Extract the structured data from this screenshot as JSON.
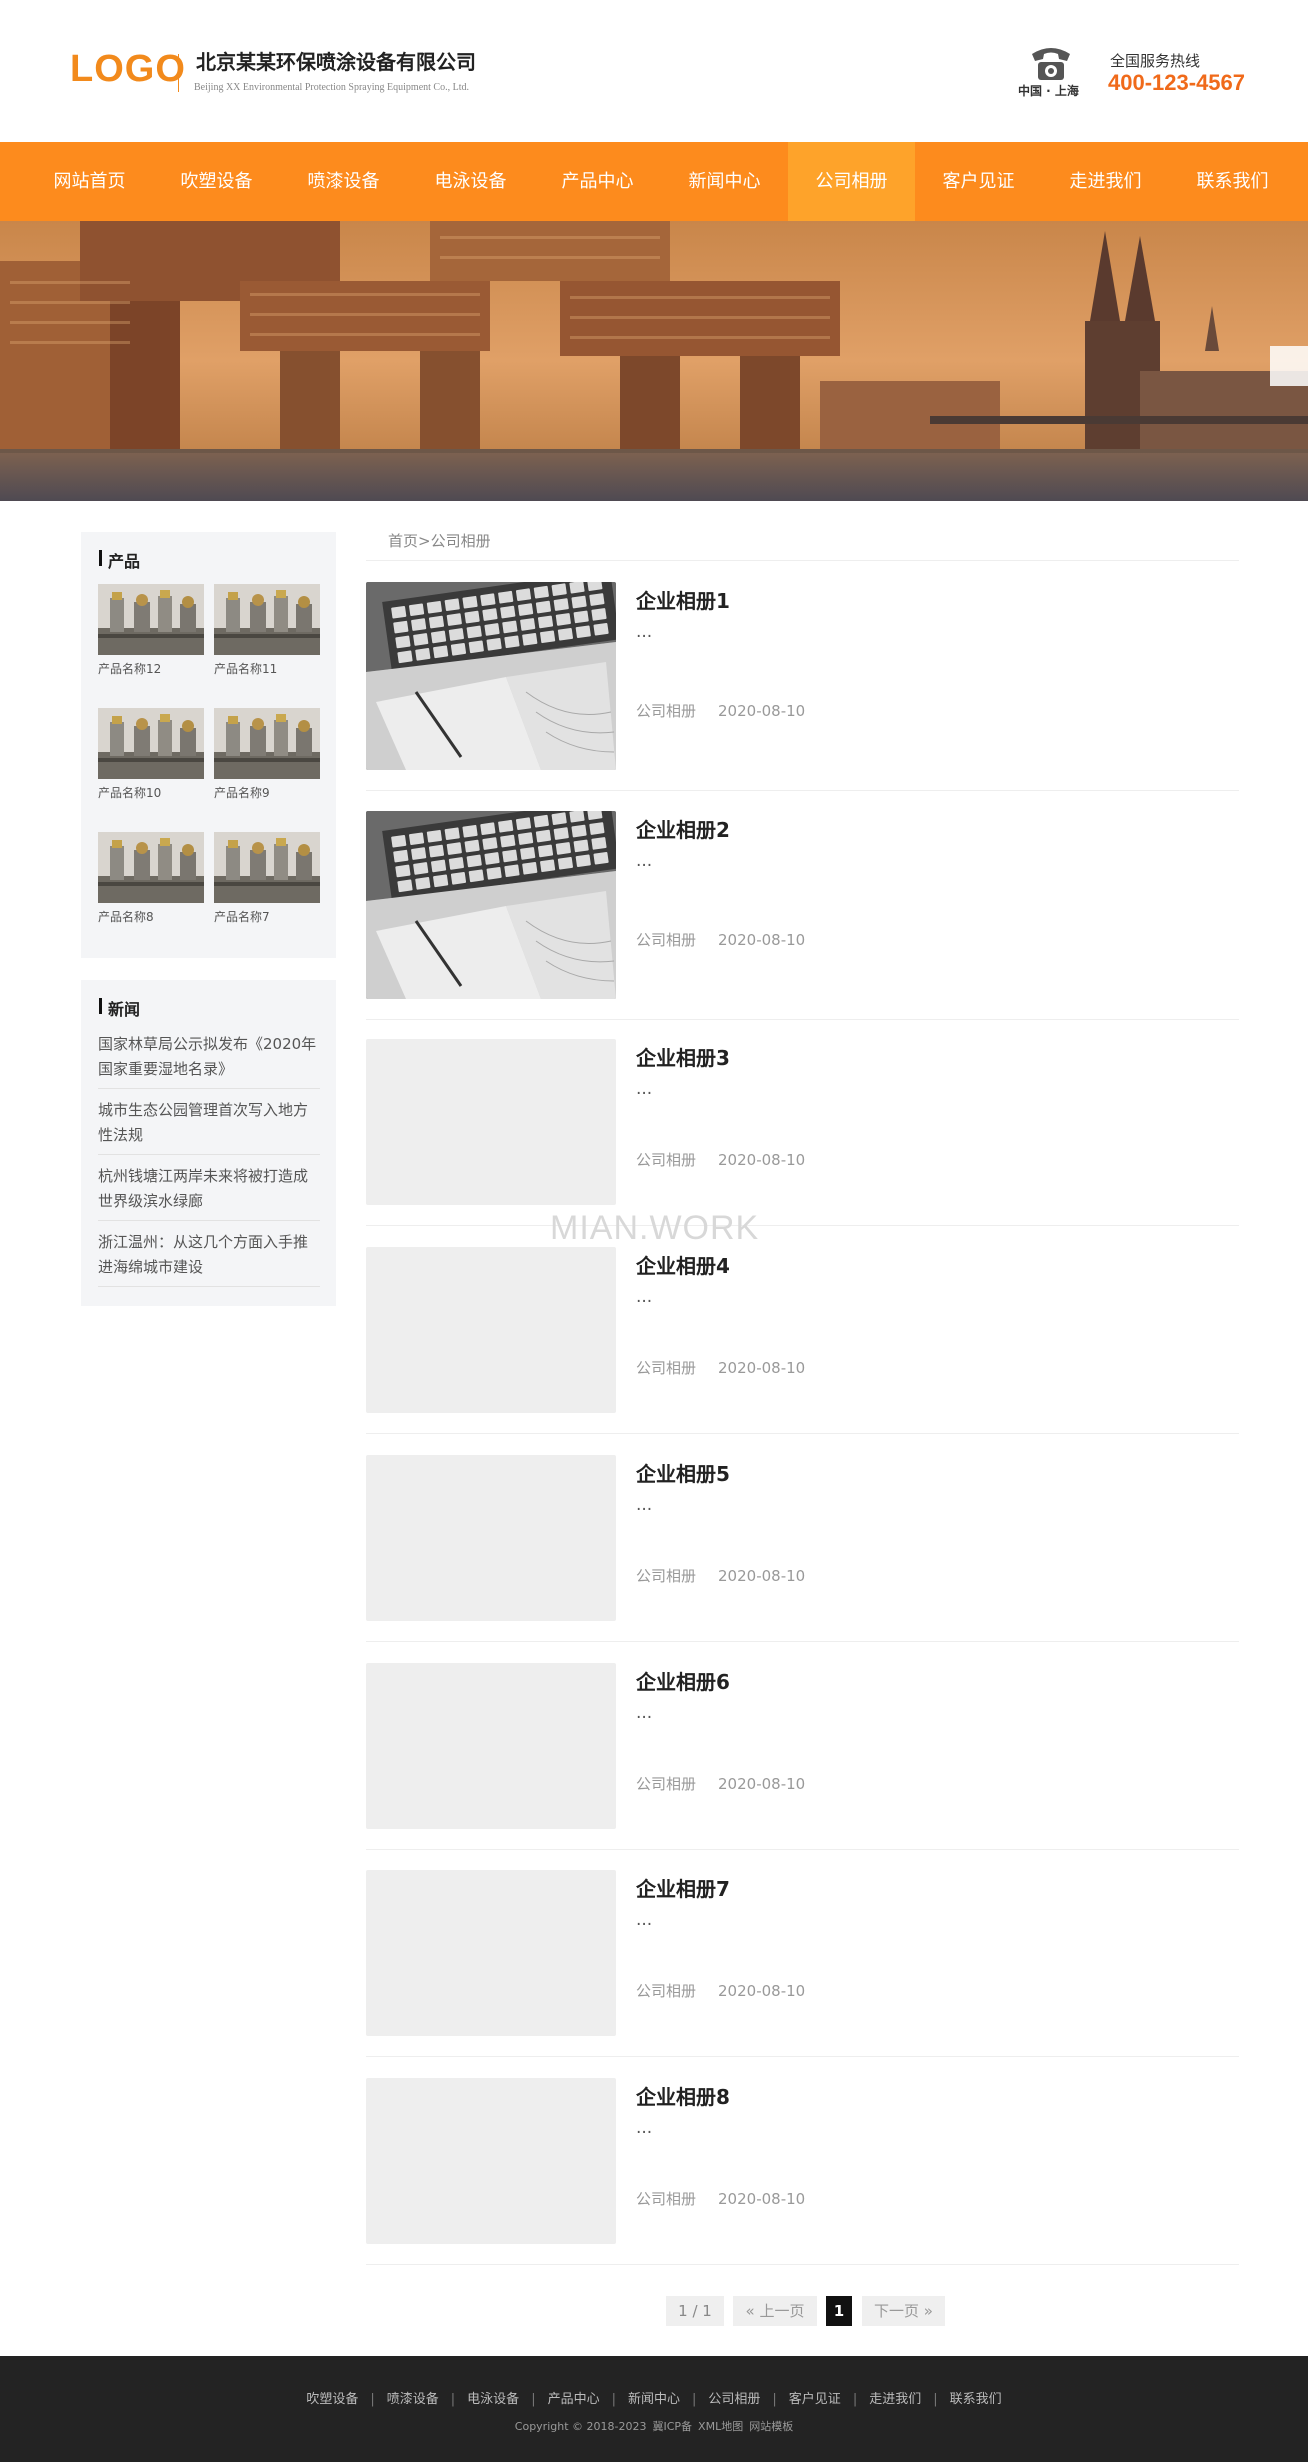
{
  "header": {
    "logo_text": "LOGO",
    "company_name": "北京某某环保喷涂设备有限公司",
    "company_name_en": "Beijing XX Environmental Protection Spraying Equipment Co., Ltd.",
    "phone_region": "中国 · 上海",
    "hotline_label": "全国服务热线",
    "hotline_number": "400-123-4567"
  },
  "nav": {
    "items": [
      "网站首页",
      "吹塑设备",
      "喷漆设备",
      "电泳设备",
      "产品中心",
      "新闻中心",
      "公司相册",
      "客户见证",
      "走进我们",
      "联系我们"
    ],
    "active_index": 6
  },
  "sidebar": {
    "products_title": "产品",
    "products": [
      "产品名称12",
      "产品名称11",
      "产品名称10",
      "产品名称9",
      "产品名称8",
      "产品名称7"
    ],
    "news_title": "新闻",
    "news": [
      "国家林草局公示拟发布《2020年国家重要湿地名录》",
      "城市生态公园管理首次写入地方性法规",
      "杭州钱塘江两岸未来将被打造成世界级滨水绿廊",
      "浙江温州：从这几个方面入手推进海绵城市建设"
    ]
  },
  "breadcrumb": {
    "home": "首页",
    "separator": ">",
    "current": "公司相册"
  },
  "entries": [
    {
      "title": "企业相册1",
      "desc": "...",
      "category": "公司相册",
      "date": "2020-08-10",
      "has_image": true
    },
    {
      "title": "企业相册2",
      "desc": "...",
      "category": "公司相册",
      "date": "2020-08-10",
      "has_image": true
    },
    {
      "title": "企业相册3",
      "desc": "...",
      "category": "公司相册",
      "date": "2020-08-10",
      "has_image": false
    },
    {
      "title": "企业相册4",
      "desc": "...",
      "category": "公司相册",
      "date": "2020-08-10",
      "has_image": false
    },
    {
      "title": "企业相册5",
      "desc": "...",
      "category": "公司相册",
      "date": "2020-08-10",
      "has_image": false
    },
    {
      "title": "企业相册6",
      "desc": "...",
      "category": "公司相册",
      "date": "2020-08-10",
      "has_image": false
    },
    {
      "title": "企业相册7",
      "desc": "...",
      "category": "公司相册",
      "date": "2020-08-10",
      "has_image": false
    },
    {
      "title": "企业相册8",
      "desc": "...",
      "category": "公司相册",
      "date": "2020-08-10",
      "has_image": false
    }
  ],
  "watermark": "MIAN.WORK",
  "pagination": {
    "info": "1 / 1",
    "prev": "« 上一页",
    "current": "1",
    "next": "下一页 »"
  },
  "footer": {
    "links": [
      "吹塑设备",
      "喷漆设备",
      "电泳设备",
      "产品中心",
      "新闻中心",
      "公司相册",
      "客户见证",
      "走进我们",
      "联系我们"
    ],
    "copyright": "Copyright © 2018-2023",
    "icp": "冀ICP备",
    "sitemap": "XML地图",
    "template": "网站模板"
  },
  "colors": {
    "nav_bg": "#fd8b1d",
    "nav_active": "#fea32a",
    "logo": "#f28a1c",
    "hotline": "#f06a1a",
    "footer_bg": "#232323"
  }
}
